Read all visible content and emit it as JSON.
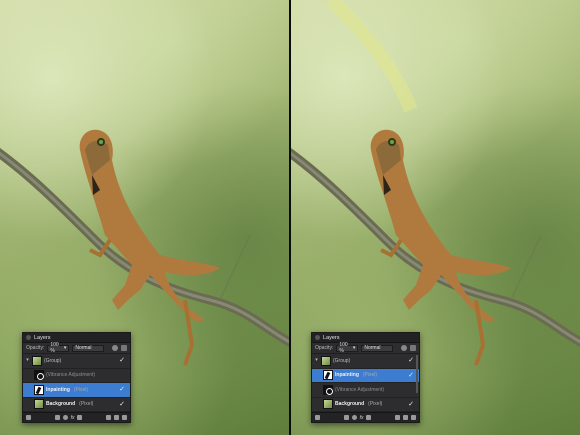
{
  "panels": [
    {
      "title": "Layers",
      "opacity_label": "Opacity:",
      "opacity_value": "100 %",
      "blend_mode": "Normal",
      "layers": [
        {
          "name": "(Group)",
          "kind": "",
          "selected": false,
          "visible": true,
          "thumb": "lizard"
        },
        {
          "name": "(Vibrance Adjustment)",
          "kind": "",
          "selected": false,
          "visible": false,
          "thumb": "vibrance"
        },
        {
          "name": "Inpainting",
          "kind": "(Pixel)",
          "selected": true,
          "visible": true,
          "thumb": "mask"
        },
        {
          "name": "Background",
          "kind": "(Pixel)",
          "selected": false,
          "visible": true,
          "thumb": "lizard"
        }
      ],
      "footer_fx": "fx"
    },
    {
      "title": "Layers",
      "opacity_label": "Opacity:",
      "opacity_value": "100 %",
      "blend_mode": "Normal",
      "layers": [
        {
          "name": "(Group)",
          "kind": "",
          "selected": false,
          "visible": true,
          "thumb": "lizard"
        },
        {
          "name": "Inpainting",
          "kind": "(Pixel)",
          "selected": true,
          "visible": true,
          "thumb": "mask"
        },
        {
          "name": "(Vibrance Adjustment)",
          "kind": "",
          "selected": false,
          "visible": false,
          "thumb": "vibrance"
        },
        {
          "name": "Background",
          "kind": "(Pixel)",
          "selected": false,
          "visible": true,
          "thumb": "lizard"
        }
      ],
      "footer_fx": "fx"
    }
  ],
  "colors": {
    "selected_row": "#3d7dd1",
    "panel_bg": "#2d2d2f"
  },
  "icons": [
    "close-icon",
    "brush-tool-icon",
    "lock-icon",
    "eye-icon",
    "expand-arrow-icon",
    "checkmark-icon",
    "layers-icon",
    "adjustment-icon",
    "fx-icon",
    "trash-icon"
  ]
}
